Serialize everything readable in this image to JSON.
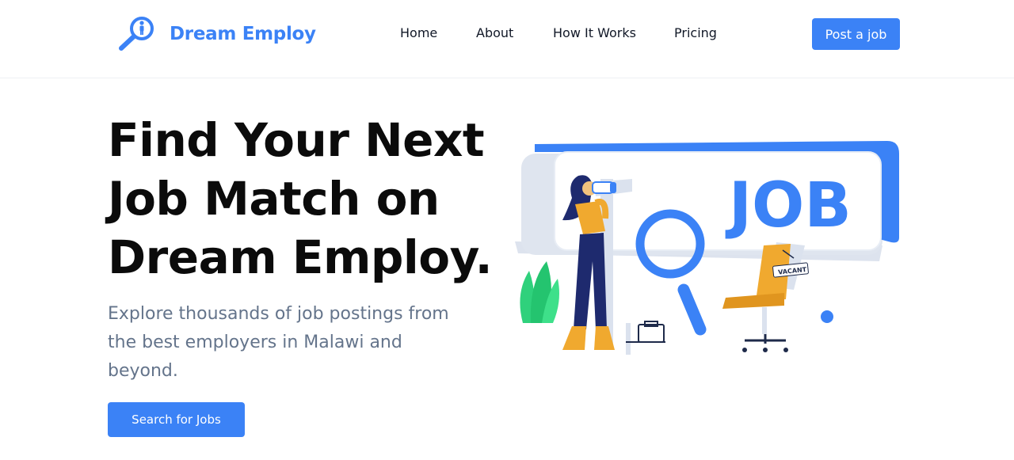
{
  "brand": {
    "name": "Dream Employ",
    "logo_icon": "magnifier-person-icon",
    "color": "#3b82f6"
  },
  "nav": {
    "items": [
      {
        "label": "Home"
      },
      {
        "label": "About"
      },
      {
        "label": "How It Works"
      },
      {
        "label": "Pricing"
      }
    ],
    "cta_label": "Post a job"
  },
  "hero": {
    "title_lines": [
      "Find Your Next",
      "Job Match on",
      "Dream Employ."
    ],
    "subtitle_lines": [
      "Explore thousands of job postings from",
      "the best employers in Malawi and",
      "beyond."
    ],
    "button_label": "Search for Jobs"
  },
  "illustration": {
    "sign_text": "JOB",
    "chair_tag": "VACANT",
    "accent_color": "#3b82f6",
    "secondary_color": "#f0a92f",
    "plant_color": "#2fd17c"
  }
}
